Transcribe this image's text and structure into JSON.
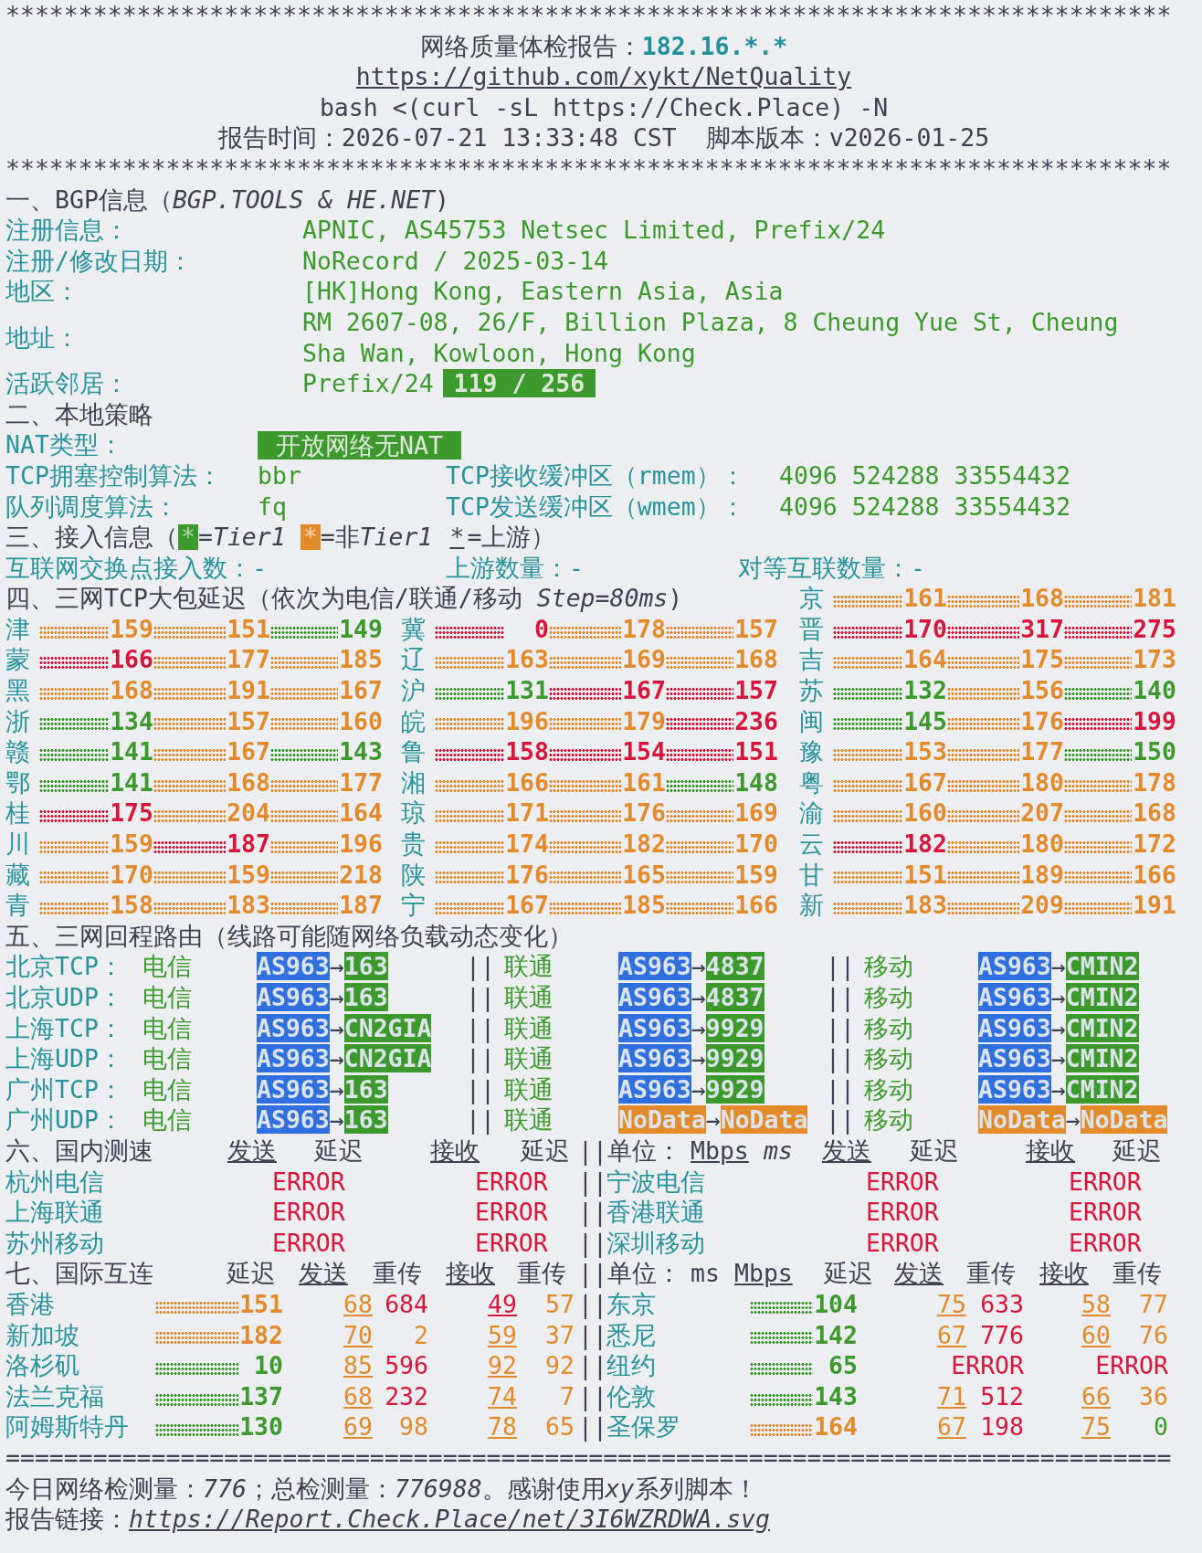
{
  "header": {
    "border_top": "********************************************************************************",
    "title": "网络质量体检报告：",
    "ip": "182.16.*.*",
    "repo_link": "https://github.com/xykt/NetQuality",
    "command": "bash <(curl -sL https://Check.Place) -N",
    "report_time": "报告时间：2026-07-21 13:33:48 CST  脚本版本：v2026-01-25",
    "border_bottom": "********************************************************************************"
  },
  "bgp": {
    "heading": "一、BGP信息（*BGP.TOOLS & HE.NET*)",
    "fields": [
      {
        "label": "注册信息：",
        "value": "APNIC, AS45753 Netsec Limited, Prefix/24"
      },
      {
        "label": "注册/修改日期：",
        "value": "NoRecord / 2025-03-14"
      },
      {
        "label": "地区：",
        "value": "[HK]Hong Kong, Eastern Asia, Asia"
      },
      {
        "label": "地址：",
        "value": "RM 2607-08, 26/F, Billion Plaza, 8 Cheung Yue St, Cheung Sha Wan, Kowloon, Hong Kong"
      },
      {
        "label": "活跃邻居：",
        "value": "Prefix/24",
        "badge": "119 / 256"
      }
    ]
  },
  "policy": {
    "heading": "二、本地策略",
    "nat_label": "NAT类型：",
    "nat_badge": "开放网络无NAT",
    "rows": [
      {
        "label": "TCP拥塞控制算法：",
        "value": "bbr",
        "buffer_label": "TCP接收缓冲区（rmem）：",
        "buffer_value": "4096 524288 33554432"
      },
      {
        "label": "队列调度算法：",
        "value": "fq",
        "buffer_label": "TCP发送缓冲区（wmem）：",
        "buffer_value": "4096 524288 33554432"
      }
    ]
  },
  "access": {
    "heading": "三、接入信息（",
    "legend": [
      {
        "kind": "tier1",
        "mark": "*",
        "label": "=",
        "term": "Tier1"
      },
      {
        "kind": "non_tier1",
        "mark": "*",
        "label": "=非",
        "term": "Tier1"
      },
      {
        "kind": "upstream",
        "mark": "*",
        "label": "=上游"
      }
    ],
    "heading_end": "）",
    "stats": [
      "互联网交换点接入数：-",
      "上游数量：-",
      "对等互联数量：-"
    ]
  },
  "latency": {
    "heading": "四、三网TCP大包延迟（依次为电信/联通/移动 *Step=80ms*)",
    "header_province": {
      "name": "京",
      "values": [
        {
          "text": "161",
          "color": "#e38a2b"
        },
        {
          "text": "168",
          "color": "#e38a2b"
        },
        {
          "text": "181",
          "color": "#e38a2b"
        }
      ]
    },
    "rows": [
      [
        {
          "name": "津",
          "values": [
            {
              "text": "159",
              "color": "#e38a2b"
            },
            {
              "text": "151",
              "color": "#e38a2b"
            },
            {
              "text": "149",
              "color": "#3c9a2c"
            }
          ]
        },
        {
          "name": "冀",
          "values": [
            {
              "text": "0",
              "color": "#d6163a"
            },
            {
              "text": "178",
              "color": "#e38a2b"
            },
            {
              "text": "157",
              "color": "#e38a2b"
            }
          ]
        },
        {
          "name": "晋",
          "values": [
            {
              "text": "170",
              "color": "#d6163a"
            },
            {
              "text": "317",
              "color": "#d6163a"
            },
            {
              "text": "275",
              "color": "#d6163a"
            }
          ]
        }
      ],
      [
        {
          "name": "蒙",
          "values": [
            {
              "text": "166",
              "color": "#d6163a"
            },
            {
              "text": "177",
              "color": "#e38a2b"
            },
            {
              "text": "185",
              "color": "#e38a2b"
            }
          ]
        },
        {
          "name": "辽",
          "values": [
            {
              "text": "163",
              "color": "#e38a2b"
            },
            {
              "text": "169",
              "color": "#e38a2b"
            },
            {
              "text": "168",
              "color": "#e38a2b"
            }
          ]
        },
        {
          "name": "吉",
          "values": [
            {
              "text": "164",
              "color": "#e38a2b"
            },
            {
              "text": "175",
              "color": "#e38a2b"
            },
            {
              "text": "173",
              "color": "#e38a2b"
            }
          ]
        }
      ],
      [
        {
          "name": "黑",
          "values": [
            {
              "text": "168",
              "color": "#e38a2b"
            },
            {
              "text": "191",
              "color": "#e38a2b"
            },
            {
              "text": "167",
              "color": "#e38a2b"
            }
          ]
        },
        {
          "name": "沪",
          "values": [
            {
              "text": "131",
              "color": "#3c9a2c"
            },
            {
              "text": "167",
              "color": "#d6163a"
            },
            {
              "text": "157",
              "color": "#d6163a"
            }
          ]
        },
        {
          "name": "苏",
          "values": [
            {
              "text": "132",
              "color": "#3c9a2c"
            },
            {
              "text": "156",
              "color": "#e38a2b"
            },
            {
              "text": "140",
              "color": "#3c9a2c"
            }
          ]
        }
      ],
      [
        {
          "name": "浙",
          "values": [
            {
              "text": "134",
              "color": "#3c9a2c"
            },
            {
              "text": "157",
              "color": "#e38a2b"
            },
            {
              "text": "160",
              "color": "#e38a2b"
            }
          ]
        },
        {
          "name": "皖",
          "values": [
            {
              "text": "196",
              "color": "#e38a2b"
            },
            {
              "text": "179",
              "color": "#e38a2b"
            },
            {
              "text": "236",
              "color": "#d6163a"
            }
          ]
        },
        {
          "name": "闽",
          "values": [
            {
              "text": "145",
              "color": "#3c9a2c"
            },
            {
              "text": "176",
              "color": "#e38a2b"
            },
            {
              "text": "199",
              "color": "#d6163a"
            }
          ]
        }
      ],
      [
        {
          "name": "赣",
          "values": [
            {
              "text": "141",
              "color": "#3c9a2c"
            },
            {
              "text": "167",
              "color": "#e38a2b"
            },
            {
              "text": "143",
              "color": "#3c9a2c"
            }
          ]
        },
        {
          "name": "鲁",
          "values": [
            {
              "text": "158",
              "color": "#d6163a"
            },
            {
              "text": "154",
              "color": "#d6163a"
            },
            {
              "text": "151",
              "color": "#d6163a"
            }
          ]
        },
        {
          "name": "豫",
          "values": [
            {
              "text": "153",
              "color": "#e38a2b"
            },
            {
              "text": "177",
              "color": "#e38a2b"
            },
            {
              "text": "150",
              "color": "#3c9a2c"
            }
          ]
        }
      ],
      [
        {
          "name": "鄂",
          "values": [
            {
              "text": "141",
              "color": "#3c9a2c"
            },
            {
              "text": "168",
              "color": "#e38a2b"
            },
            {
              "text": "177",
              "color": "#e38a2b"
            }
          ]
        },
        {
          "name": "湘",
          "values": [
            {
              "text": "166",
              "color": "#e38a2b"
            },
            {
              "text": "161",
              "color": "#e38a2b"
            },
            {
              "text": "148",
              "color": "#3c9a2c"
            }
          ]
        },
        {
          "name": "粤",
          "values": [
            {
              "text": "167",
              "color": "#e38a2b"
            },
            {
              "text": "180",
              "color": "#e38a2b"
            },
            {
              "text": "178",
              "color": "#e38a2b"
            }
          ]
        }
      ],
      [
        {
          "name": "桂",
          "values": [
            {
              "text": "175",
              "color": "#d6163a"
            },
            {
              "text": "204",
              "color": "#e38a2b"
            },
            {
              "text": "164",
              "color": "#e38a2b"
            }
          ]
        },
        {
          "name": "琼",
          "values": [
            {
              "text": "171",
              "color": "#e38a2b"
            },
            {
              "text": "176",
              "color": "#e38a2b"
            },
            {
              "text": "169",
              "color": "#e38a2b"
            }
          ]
        },
        {
          "name": "渝",
          "values": [
            {
              "text": "160",
              "color": "#e38a2b"
            },
            {
              "text": "207",
              "color": "#e38a2b"
            },
            {
              "text": "168",
              "color": "#e38a2b"
            }
          ]
        }
      ],
      [
        {
          "name": "川",
          "values": [
            {
              "text": "159",
              "color": "#e38a2b"
            },
            {
              "text": "187",
              "color": "#d6163a"
            },
            {
              "text": "196",
              "color": "#e38a2b"
            }
          ]
        },
        {
          "name": "贵",
          "values": [
            {
              "text": "174",
              "color": "#e38a2b"
            },
            {
              "text": "182",
              "color": "#e38a2b"
            },
            {
              "text": "170",
              "color": "#e38a2b"
            }
          ]
        },
        {
          "name": "云",
          "values": [
            {
              "text": "182",
              "color": "#d6163a"
            },
            {
              "text": "180",
              "color": "#e38a2b"
            },
            {
              "text": "172",
              "color": "#e38a2b"
            }
          ]
        }
      ],
      [
        {
          "name": "藏",
          "values": [
            {
              "text": "170",
              "color": "#e38a2b"
            },
            {
              "text": "159",
              "color": "#e38a2b"
            },
            {
              "text": "218",
              "color": "#e38a2b"
            }
          ]
        },
        {
          "name": "陕",
          "values": [
            {
              "text": "176",
              "color": "#e38a2b"
            },
            {
              "text": "165",
              "color": "#e38a2b"
            },
            {
              "text": "159",
              "color": "#e38a2b"
            }
          ]
        },
        {
          "name": "甘",
          "values": [
            {
              "text": "151",
              "color": "#e38a2b"
            },
            {
              "text": "189",
              "color": "#e38a2b"
            },
            {
              "text": "166",
              "color": "#e38a2b"
            }
          ]
        }
      ],
      [
        {
          "name": "青",
          "values": [
            {
              "text": "158",
              "color": "#e38a2b"
            },
            {
              "text": "183",
              "color": "#e38a2b"
            },
            {
              "text": "187",
              "color": "#e38a2b"
            }
          ]
        },
        {
          "name": "宁",
          "values": [
            {
              "text": "167",
              "color": "#e38a2b"
            },
            {
              "text": "185",
              "color": "#e38a2b"
            },
            {
              "text": "166",
              "color": "#e38a2b"
            }
          ]
        },
        {
          "name": "新",
          "values": [
            {
              "text": "183",
              "color": "#e38a2b"
            },
            {
              "text": "209",
              "color": "#e38a2b"
            },
            {
              "text": "191",
              "color": "#e38a2b"
            }
          ]
        }
      ]
    ]
  },
  "routes": {
    "heading": "五、三网回程路由（线路可能随网络负载动态变化）",
    "rows": [
      {
        "label": "北京TCP：",
        "routes": [
          {
            "carrier": "电信",
            "from": {
              "text": "AS963",
              "color": "#2f6fde"
            },
            "arrow": "→",
            "to": {
              "text": "163",
              "color": "#3c9a2c"
            }
          },
          {
            "separator": "||",
            "carrier": "联通",
            "from": {
              "text": "AS963",
              "color": "#2f6fde"
            },
            "arrow": "→",
            "to": {
              "text": "4837",
              "color": "#3c9a2c"
            }
          },
          {
            "separator": "||",
            "carrier": "移动",
            "from": {
              "text": "AS963",
              "color": "#2f6fde"
            },
            "arrow": "→",
            "to": {
              "text": "CMIN2",
              "color": "#3c9a2c"
            }
          }
        ]
      },
      {
        "label": "北京UDP：",
        "routes": [
          {
            "carrier": "电信",
            "from": {
              "text": "AS963",
              "color": "#2f6fde"
            },
            "arrow": "→",
            "to": {
              "text": "163",
              "color": "#3c9a2c"
            }
          },
          {
            "separator": "||",
            "carrier": "联通",
            "from": {
              "text": "AS963",
              "color": "#2f6fde"
            },
            "arrow": "→",
            "to": {
              "text": "4837",
              "color": "#3c9a2c"
            }
          },
          {
            "separator": "||",
            "carrier": "移动",
            "from": {
              "text": "AS963",
              "color": "#2f6fde"
            },
            "arrow": "→",
            "to": {
              "text": "CMIN2",
              "color": "#3c9a2c"
            }
          }
        ]
      },
      {
        "label": "上海TCP：",
        "routes": [
          {
            "carrier": "电信",
            "from": {
              "text": "AS963",
              "color": "#2f6fde"
            },
            "arrow": "→",
            "to": {
              "text": "CN2GIA",
              "color": "#3c9a2c"
            }
          },
          {
            "separator": "||",
            "carrier": "联通",
            "from": {
              "text": "AS963",
              "color": "#2f6fde"
            },
            "arrow": "→",
            "to": {
              "text": "9929",
              "color": "#3c9a2c"
            }
          },
          {
            "separator": "||",
            "carrier": "移动",
            "from": {
              "text": "AS963",
              "color": "#2f6fde"
            },
            "arrow": "→",
            "to": {
              "text": "CMIN2",
              "color": "#3c9a2c"
            }
          }
        ]
      },
      {
        "label": "上海UDP：",
        "routes": [
          {
            "carrier": "电信",
            "from": {
              "text": "AS963",
              "color": "#2f6fde"
            },
            "arrow": "→",
            "to": {
              "text": "CN2GIA",
              "color": "#3c9a2c"
            }
          },
          {
            "separator": "||",
            "carrier": "联通",
            "from": {
              "text": "AS963",
              "color": "#2f6fde"
            },
            "arrow": "→",
            "to": {
              "text": "9929",
              "color": "#3c9a2c"
            }
          },
          {
            "separator": "||",
            "carrier": "移动",
            "from": {
              "text": "AS963",
              "color": "#2f6fde"
            },
            "arrow": "→",
            "to": {
              "text": "CMIN2",
              "color": "#3c9a2c"
            }
          }
        ]
      },
      {
        "label": "广州TCP：",
        "routes": [
          {
            "carrier": "电信",
            "from": {
              "text": "AS963",
              "color": "#2f6fde"
            },
            "arrow": "→",
            "to": {
              "text": "163",
              "color": "#3c9a2c"
            }
          },
          {
            "separator": "||",
            "carrier": "联通",
            "from": {
              "text": "AS963",
              "color": "#2f6fde"
            },
            "arrow": "→",
            "to": {
              "text": "9929",
              "color": "#3c9a2c"
            }
          },
          {
            "separator": "||",
            "carrier": "移动",
            "from": {
              "text": "AS963",
              "color": "#2f6fde"
            },
            "arrow": "→",
            "to": {
              "text": "CMIN2",
              "color": "#3c9a2c"
            }
          }
        ]
      },
      {
        "label": "广州UDP：",
        "routes": [
          {
            "carrier": "电信",
            "from": {
              "text": "AS963",
              "color": "#2f6fde"
            },
            "arrow": "→",
            "to": {
              "text": "163",
              "color": "#3c9a2c"
            }
          },
          {
            "separator": "||",
            "carrier": "联通",
            "from": {
              "text": "NoData",
              "color": "#e38a2b"
            },
            "arrow": "→",
            "to": {
              "text": "NoData",
              "color": "#e38a2b"
            }
          },
          {
            "separator": "||",
            "carrier": "移动",
            "from": {
              "text": "NoData",
              "color": "#e38a2b"
            },
            "arrow": "→",
            "to": {
              "text": "NoData",
              "color": "#e38a2b"
            }
          }
        ]
      }
    ]
  },
  "domestic": {
    "header": [
      {
        "text": "六、国内测速",
        "underlined": false
      },
      {
        "text": "发送",
        "underlined": true
      },
      {
        "text": "延迟",
        "underlined": false
      },
      {
        "text": "接收",
        "underlined": true
      },
      {
        "text": "延迟",
        "underlined": false
      },
      {
        "text": "||单位：",
        "underlined": false
      },
      {
        "text": "Mbps",
        "underlined": true
      },
      {
        "text": "*ms*",
        "underlined": false
      },
      {
        "text": "发送",
        "underlined": true
      },
      {
        "text": "延迟",
        "underlined": false
      },
      {
        "text": "接收",
        "underlined": true
      },
      {
        "text": "延迟",
        "underlined": false
      }
    ],
    "rows": [
      {
        "left": {
          "name": "杭州电信",
          "results": [
            "ERROR",
            "ERROR"
          ]
        },
        "separator": "||",
        "right": {
          "name": "宁波电信",
          "results": [
            "ERROR",
            "ERROR"
          ]
        }
      },
      {
        "left": {
          "name": "上海联通",
          "results": [
            "ERROR",
            "ERROR"
          ]
        },
        "separator": "||",
        "right": {
          "name": "香港联通",
          "results": [
            "ERROR",
            "ERROR"
          ]
        }
      },
      {
        "left": {
          "name": "苏州移动",
          "results": [
            "ERROR",
            "ERROR"
          ]
        },
        "separator": "||",
        "right": {
          "name": "深圳移动",
          "results": [
            "ERROR",
            "ERROR"
          ]
        }
      }
    ]
  },
  "international": {
    "header": [
      {
        "text": "七、国际互连",
        "underlined": false
      },
      {
        "text": "延迟",
        "underlined": false
      },
      {
        "text": "发送",
        "underlined": true
      },
      {
        "text": "重传",
        "underlined": false
      },
      {
        "text": "接收",
        "underlined": true
      },
      {
        "text": "重传",
        "underlined": false
      },
      {
        "text": "||单位：",
        "underlined": false
      },
      {
        "text": "ms",
        "underlined": false
      },
      {
        "text": "Mbps",
        "underlined": true
      },
      {
        "text": "延迟",
        "underlined": false
      },
      {
        "text": "发送",
        "underlined": true
      },
      {
        "text": "重传",
        "underlined": false
      },
      {
        "text": "接收",
        "underlined": true
      },
      {
        "text": "重传",
        "underlined": false
      }
    ],
    "rows": [
      {
        "left": {
          "name": "香港",
          "latency": {
            "text": "151",
            "color": "#e38a2b"
          },
          "metrics": [
            {
              "kind": "rate",
              "text": "68",
              "color": "#e38a2b"
            },
            {
              "kind": "retrans",
              "text": "684",
              "color": "#d6163a"
            },
            {
              "kind": "rate",
              "text": "49",
              "color": "#d6163a"
            },
            {
              "kind": "retrans",
              "text": "57",
              "color": "#e38a2b"
            }
          ]
        },
        "separator": "||",
        "right": {
          "name": "东京",
          "latency": {
            "text": "104",
            "color": "#3c9a2c"
          },
          "metrics": [
            {
              "kind": "rate",
              "text": "75",
              "color": "#e38a2b"
            },
            {
              "kind": "retrans",
              "text": "633",
              "color": "#d6163a"
            },
            {
              "kind": "rate",
              "text": "58",
              "color": "#e38a2b"
            },
            {
              "kind": "retrans",
              "text": "77",
              "color": "#e38a2b"
            }
          ]
        }
      },
      {
        "left": {
          "name": "新加坡",
          "latency": {
            "text": "182",
            "color": "#e38a2b"
          },
          "metrics": [
            {
              "kind": "rate",
              "text": "70",
              "color": "#e38a2b"
            },
            {
              "kind": "retrans",
              "text": "2",
              "color": "#e38a2b"
            },
            {
              "kind": "rate",
              "text": "59",
              "color": "#e38a2b"
            },
            {
              "kind": "retrans",
              "text": "37",
              "color": "#e38a2b"
            }
          ]
        },
        "separator": "||",
        "right": {
          "name": "悉尼",
          "latency": {
            "text": "142",
            "color": "#3c9a2c"
          },
          "metrics": [
            {
              "kind": "rate",
              "text": "67",
              "color": "#e38a2b"
            },
            {
              "kind": "retrans",
              "text": "776",
              "color": "#d6163a"
            },
            {
              "kind": "rate",
              "text": "60",
              "color": "#e38a2b"
            },
            {
              "kind": "retrans",
              "text": "76",
              "color": "#e38a2b"
            }
          ]
        }
      },
      {
        "left": {
          "name": "洛杉矶",
          "latency": {
            "text": "10",
            "color": "#3c9a2c"
          },
          "metrics": [
            {
              "kind": "rate",
              "text": "85",
              "color": "#e38a2b"
            },
            {
              "kind": "retrans",
              "text": "596",
              "color": "#d6163a"
            },
            {
              "kind": "rate",
              "text": "92",
              "color": "#e38a2b"
            },
            {
              "kind": "retrans",
              "text": "92",
              "color": "#e38a2b"
            }
          ]
        },
        "separator": "||",
        "right": {
          "name": "纽约",
          "latency": {
            "text": "65",
            "color": "#3c9a2c"
          },
          "metrics": [
            {
              "kind": "error",
              "text": "ERROR",
              "color": "#d6163a"
            },
            {
              "kind": "error",
              "text": "ERROR",
              "color": "#d6163a"
            }
          ]
        }
      },
      {
        "left": {
          "name": "法兰克福",
          "latency": {
            "text": "137",
            "color": "#3c9a2c"
          },
          "metrics": [
            {
              "kind": "rate",
              "text": "68",
              "color": "#e38a2b"
            },
            {
              "kind": "retrans",
              "text": "232",
              "color": "#d6163a"
            },
            {
              "kind": "rate",
              "text": "74",
              "color": "#e38a2b"
            },
            {
              "kind": "retrans",
              "text": "7",
              "color": "#e38a2b"
            }
          ]
        },
        "separator": "||",
        "right": {
          "name": "伦敦",
          "latency": {
            "text": "143",
            "color": "#3c9a2c"
          },
          "metrics": [
            {
              "kind": "rate",
              "text": "71",
              "color": "#e38a2b"
            },
            {
              "kind": "retrans",
              "text": "512",
              "color": "#d6163a"
            },
            {
              "kind": "rate",
              "text": "66",
              "color": "#e38a2b"
            },
            {
              "kind": "retrans",
              "text": "36",
              "color": "#e38a2b"
            }
          ]
        }
      },
      {
        "left": {
          "name": "阿姆斯特丹",
          "latency": {
            "text": "130",
            "color": "#3c9a2c"
          },
          "metrics": [
            {
              "kind": "rate",
              "text": "69",
              "color": "#e38a2b"
            },
            {
              "kind": "retrans",
              "text": "98",
              "color": "#e38a2b"
            },
            {
              "kind": "rate",
              "text": "78",
              "color": "#e38a2b"
            },
            {
              "kind": "retrans",
              "text": "65",
              "color": "#e38a2b"
            }
          ]
        },
        "separator": "||",
        "right": {
          "name": "圣保罗",
          "latency": {
            "text": "164",
            "color": "#e38a2b"
          },
          "metrics": [
            {
              "kind": "rate",
              "text": "67",
              "color": "#e38a2b"
            },
            {
              "kind": "retrans",
              "text": "198",
              "color": "#d6163a"
            },
            {
              "kind": "rate",
              "text": "75",
              "color": "#e38a2b"
            },
            {
              "kind": "retrans",
              "text": "0",
              "color": "#3c9a2c"
            }
          ]
        }
      }
    ]
  },
  "footer": {
    "border": "================================================================================",
    "stats": [
      {
        "text": "今日网络检测量：",
        "italic": false
      },
      {
        "text": "776",
        "italic": true
      },
      {
        "text": "；总检测量：",
        "italic": false
      },
      {
        "text": "776988",
        "italic": true
      },
      {
        "text": "。感谢使用",
        "italic": false
      },
      {
        "text": "xy",
        "italic": true
      },
      {
        "text": "系列脚本！",
        "italic": false
      }
    ],
    "link_label": "报告链接：",
    "link": "https://Report.Check.Place/net/3I6WZRDWA.svg"
  }
}
